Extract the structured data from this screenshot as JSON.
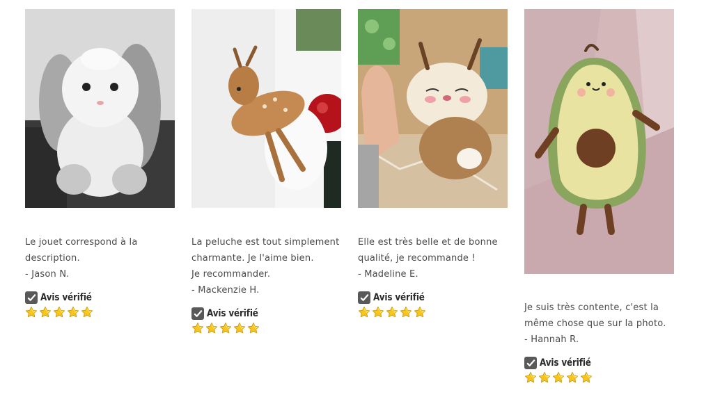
{
  "reviews": [
    {
      "lines": [
        "Le jouet correspond à la",
        "description.",
        "- Jason N."
      ],
      "photo_icon": "bunny-plush-photo",
      "verified_label": "Avis vérifié",
      "rating": 5
    },
    {
      "lines": [
        "La peluche est tout simplement",
        "charmante. Je l'aime bien.",
        "Je recommander.",
        "- Mackenzie H."
      ],
      "photo_icon": "fawn-plush-photo",
      "verified_label": "Avis vérifié",
      "rating": 5
    },
    {
      "lines": [
        "Elle est très belle et de bonne",
        "qualité, je recommande !",
        "- Madeline E."
      ],
      "photo_icon": "reindeer-plush-photo",
      "verified_label": "Avis vérifié",
      "rating": 5
    },
    {
      "lines": [
        "Je suis très contente, c'est la",
        "même chose que sur la photo.",
        "- Hannah R."
      ],
      "photo_icon": "avocado-plush-photo",
      "verified_label": "Avis vérifié",
      "rating": 5
    }
  ],
  "colors": {
    "text": "#4a4a4a",
    "star_fill": "#f5c518",
    "check_box": "#595959"
  }
}
